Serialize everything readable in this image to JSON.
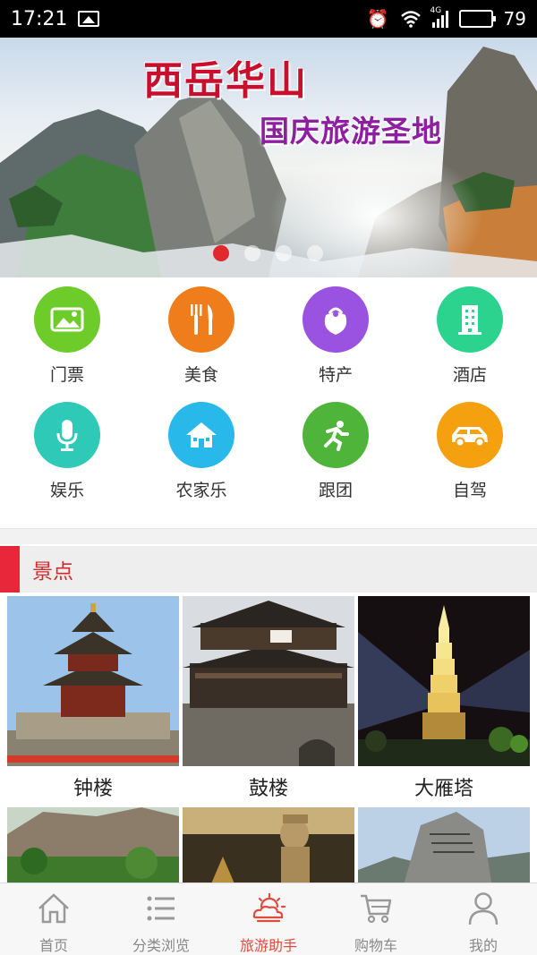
{
  "status_bar": {
    "time": "17:21",
    "network": "4G",
    "battery": "79",
    "battery_level": 0.79
  },
  "banner": {
    "title": "西岳华山",
    "subtitle": "国庆旅游圣地",
    "slide_count": 4,
    "active_slide": 1
  },
  "categories": [
    {
      "label": "门票",
      "icon": "ticket-image-icon",
      "color": "#6dcb2a"
    },
    {
      "label": "美食",
      "icon": "fork-knife-icon",
      "color": "#f07d1c"
    },
    {
      "label": "特产",
      "icon": "gift-bag-icon",
      "color": "#9a52e0"
    },
    {
      "label": "酒店",
      "icon": "hotel-building-icon",
      "color": "#2bd38f"
    },
    {
      "label": "娱乐",
      "icon": "microphone-icon",
      "color": "#2ec9b7"
    },
    {
      "label": "农家乐",
      "icon": "farmhouse-icon",
      "color": "#28b9ea"
    },
    {
      "label": "跟团",
      "icon": "running-person-icon",
      "color": "#4fb43a"
    },
    {
      "label": "自驾",
      "icon": "car-icon",
      "color": "#f5a10f"
    }
  ],
  "section": {
    "title": "景点"
  },
  "spots": [
    {
      "name": "钟楼"
    },
    {
      "name": "鼓楼"
    },
    {
      "name": "大雁塔"
    },
    {
      "name": ""
    },
    {
      "name": ""
    },
    {
      "name": ""
    }
  ],
  "tabs": [
    {
      "label": "首页",
      "icon": "home-icon",
      "active": false
    },
    {
      "label": "分类浏览",
      "icon": "list-icon",
      "active": false
    },
    {
      "label": "旅游助手",
      "icon": "sun-cloud-icon",
      "active": true
    },
    {
      "label": "购物车",
      "icon": "cart-icon",
      "active": false
    },
    {
      "label": "我的",
      "icon": "person-icon",
      "active": false
    }
  ],
  "colors": {
    "accent": "#e8273a",
    "tab_active": "#e14b3c"
  }
}
